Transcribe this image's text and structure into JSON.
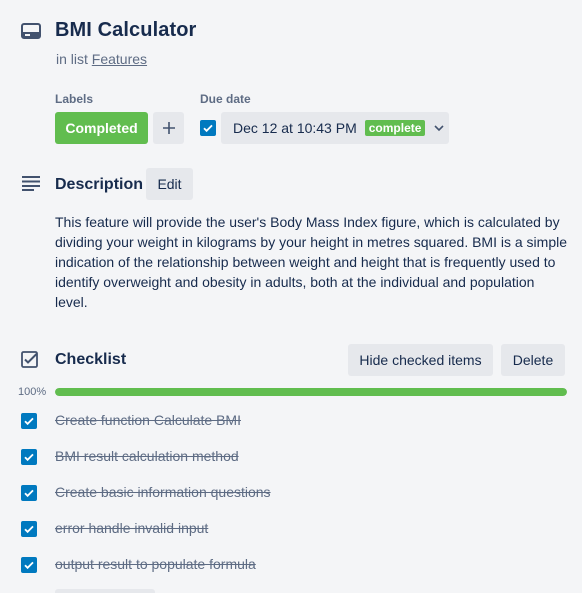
{
  "card": {
    "title": "BMI Calculator",
    "in_list_prefix": "in list",
    "list_name": "Features"
  },
  "labels": {
    "heading": "Labels",
    "items": [
      "Completed"
    ],
    "add_icon": "plus-icon"
  },
  "due": {
    "heading": "Due date",
    "checked": true,
    "date_text": "Dec 12 at 10:43 PM",
    "badge": "complete"
  },
  "description": {
    "heading": "Description",
    "edit_label": "Edit",
    "text": "This feature will provide the user's Body Mass Index figure, which is calculated by dividing your weight in kilograms by your height in metres squared. BMI is a simple indication of the relationship between weight and height that is frequently used to identify overweight and obesity in adults, both at the individual and population level."
  },
  "checklist": {
    "heading": "Checklist",
    "hide_label": "Hide checked items",
    "delete_label": "Delete",
    "progress_text": "100%",
    "progress_fraction": 1.0,
    "items": [
      {
        "text": "Create function Calculate BMI",
        "checked": true
      },
      {
        "text": "BMI result calculation method",
        "checked": true
      },
      {
        "text": "Create basic information questions",
        "checked": true
      },
      {
        "text": "error handle invalid input",
        "checked": true
      },
      {
        "text": "output result to populate formula",
        "checked": true
      }
    ]
  },
  "colors": {
    "green": "#61bd4f",
    "blue": "#0079bf",
    "text": "#172b4d",
    "muted": "#5e6c84",
    "button_bg": "#e6e8ec"
  }
}
